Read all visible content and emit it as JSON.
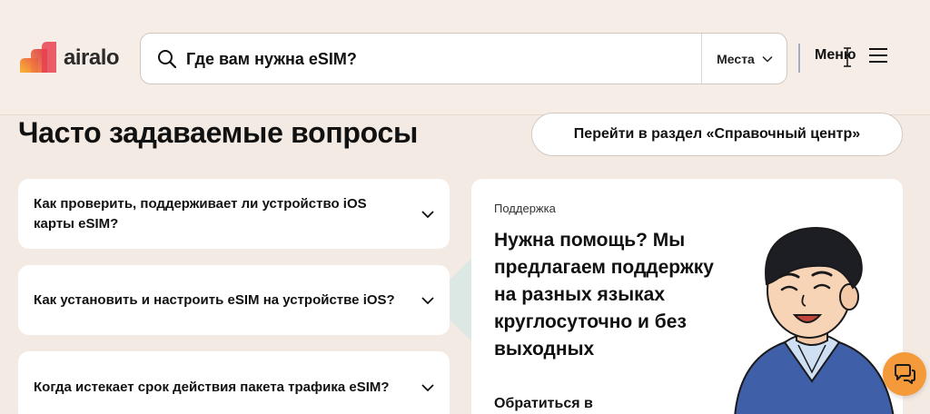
{
  "header": {
    "logo_text": "airalo",
    "search": {
      "placeholder": "Где вам нужна eSIM?"
    },
    "places_label": "Места",
    "menu_label": "Меню"
  },
  "faq": {
    "title": "Часто задаваемые вопросы",
    "help_center_label": "Перейти в раздел «Справочный центр»",
    "items": [
      {
        "question": "Как проверить, поддерживает ли устройство iOS карты eSIM?"
      },
      {
        "question": "Как установить и настроить eSIM на устройстве iOS?"
      },
      {
        "question": "Когда истекает срок действия пакета трафика eSIM?"
      }
    ]
  },
  "support": {
    "kicker": "Поддержка",
    "heading": "Нужна помощь? Мы предлагаем поддержку на разных языках круглосуточно и без выходных",
    "contact": "Обратиться в"
  },
  "icons": {
    "search": "search-icon",
    "places_dropdown": "chevron-down-icon",
    "menu": "hamburger-icon",
    "faq_toggle": "chevron-down-icon",
    "chat": "chat-bubble-icon"
  },
  "colors": {
    "page_bg": "#f3ebe3",
    "header_bg": "#f6ede6",
    "card_bg": "#ffffff",
    "chat_button": "#f59a3a",
    "divider_accent": "#9fb0c4"
  }
}
